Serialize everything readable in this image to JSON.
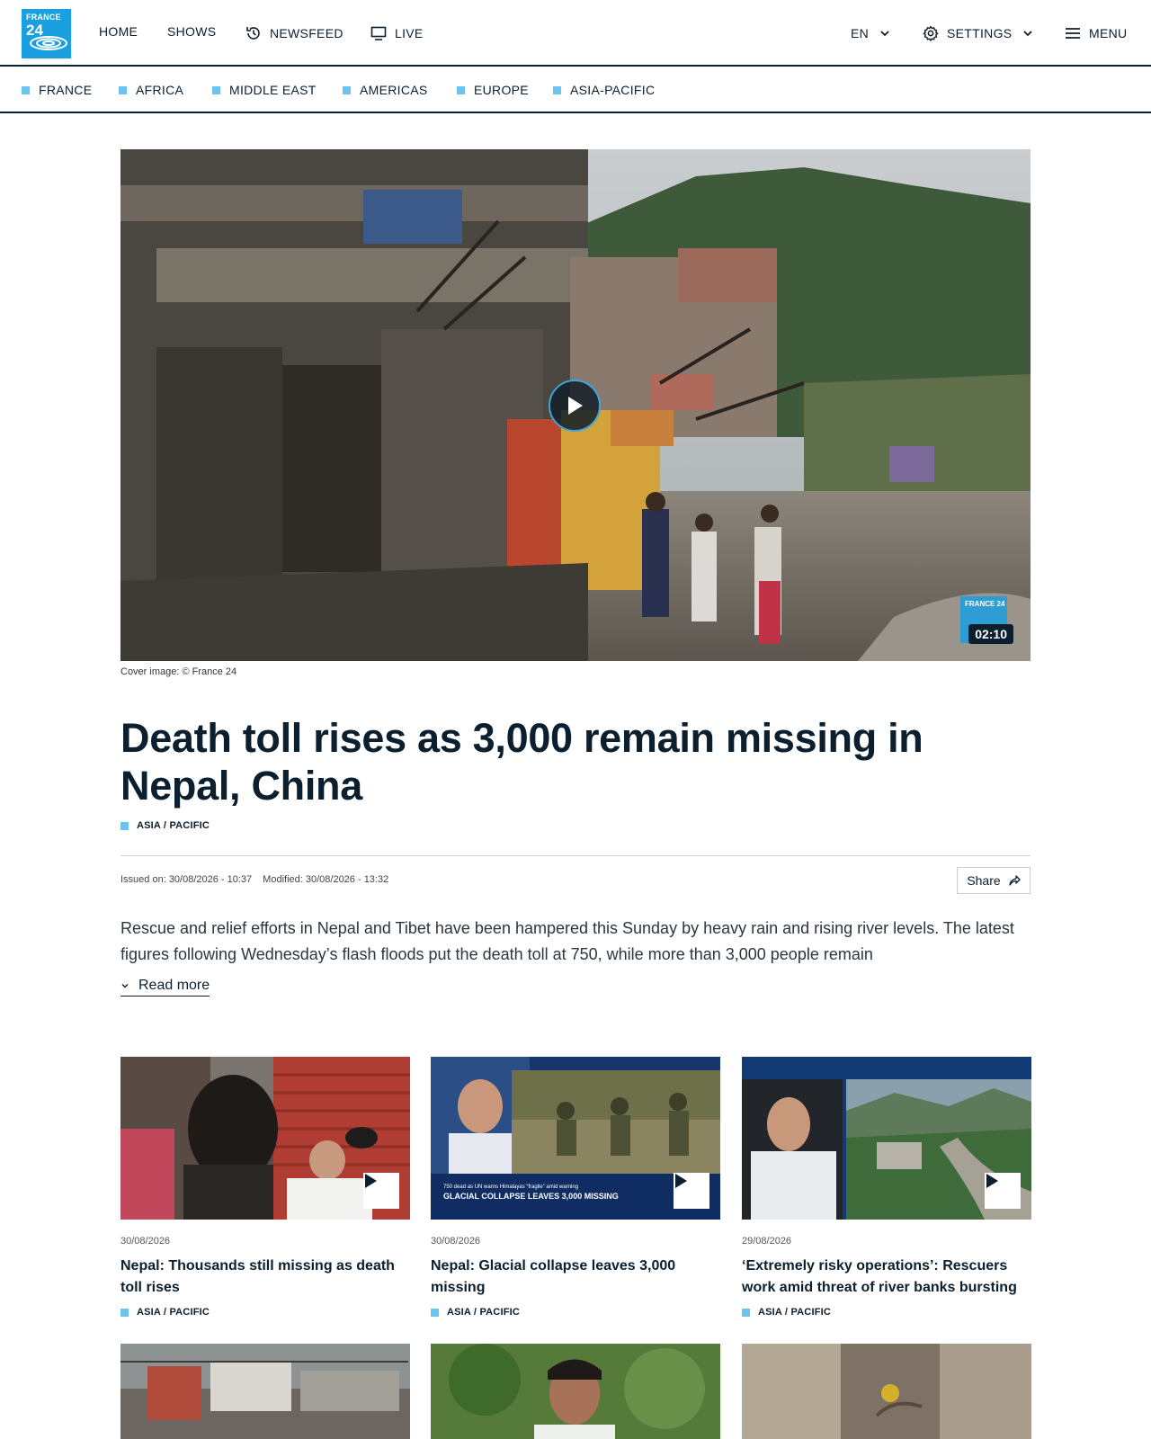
{
  "brand": {
    "logo_line1": "FRANCE",
    "logo_line2": "24",
    "accent": "#1a9fe0",
    "tag_color": "#6cc3ef",
    "text_color": "#0b1f2e"
  },
  "nav": {
    "home": "HOME",
    "shows": "SHOWS",
    "newsfeed": "NEWSFEED",
    "live": "LIVE",
    "language": "EN",
    "settings": "SETTINGS",
    "menu": "MENU"
  },
  "regions": [
    "FRANCE",
    "AFRICA",
    "MIDDLE EAST",
    "AMERICAS",
    "EUROPE",
    "ASIA-PACIFIC"
  ],
  "hero": {
    "duration": "02:10",
    "badge_text": "FRANCE 24",
    "caption": "Cover image: © France 24"
  },
  "article": {
    "headline": "Death toll rises as 3,000 remain missing in Nepal, China",
    "tag": "ASIA / PACIFIC",
    "issued": "Issued on: 30/08/2026 - 10:37",
    "modified": "Modified: 30/08/2026 - 13:32",
    "share_label": "Share",
    "lede": "Rescue and relief efforts in Nepal and Tibet have been hampered this Sunday by heavy rain and rising river levels. The latest figures following Wednesday’s flash floods put the death toll at 750, while more than 3,000 people remain",
    "read_more": "Read more"
  },
  "cards": [
    {
      "date": "30/08/2026",
      "title": "Nepal: Thousands still missing as death toll rises",
      "tag": "ASIA / PACIFIC"
    },
    {
      "date": "30/08/2026",
      "title": "Nepal: Glacial collapse leaves 3,000 missing",
      "tag": "ASIA / PACIFIC",
      "lower_third_small": "750 dead as UN warns Himalayas “fragile” amid warning",
      "lower_third_big": "GLACIAL COLLAPSE LEAVES 3,000 MISSING"
    },
    {
      "date": "29/08/2026",
      "title": "‘Extremely risky operations’: Rescuers work amid threat of river banks bursting",
      "tag": "ASIA / PACIFIC"
    }
  ]
}
